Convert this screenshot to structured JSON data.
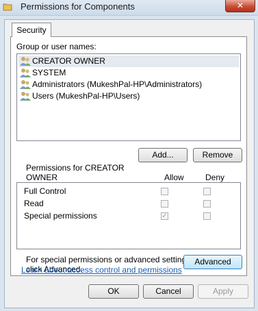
{
  "window": {
    "title": "Permissions for Components",
    "close_glyph": "✕"
  },
  "tabs": [
    {
      "label": "Security"
    }
  ],
  "group_label": "Group or user names:",
  "users": [
    {
      "name": "CREATOR OWNER",
      "selected": true
    },
    {
      "name": "SYSTEM",
      "selected": false
    },
    {
      "name": "Administrators (MukeshPal-HP\\Administrators)",
      "selected": false
    },
    {
      "name": "Users (MukeshPal-HP\\Users)",
      "selected": false
    }
  ],
  "buttons": {
    "add": "Add...",
    "remove": "Remove",
    "advanced": "Advanced",
    "ok": "OK",
    "cancel": "Cancel",
    "apply": "Apply"
  },
  "permissions": {
    "heading_line1": "Permissions for CREATOR",
    "heading_line2": "OWNER",
    "allow_label": "Allow",
    "deny_label": "Deny",
    "rows": [
      {
        "name": "Full Control",
        "allow": false,
        "deny": false
      },
      {
        "name": "Read",
        "allow": false,
        "deny": false
      },
      {
        "name": "Special permissions",
        "allow": true,
        "deny": false
      }
    ]
  },
  "special_note_line1": "For special permissions or advanced settings,",
  "special_note_line2": "click Advanced.",
  "link_text": "Learn about access control and permissions",
  "colors": {
    "close": "#c94f36",
    "link": "#1a5fb4",
    "selection": "#e5eaf0"
  },
  "icons": {
    "title": "folder-icon",
    "user": "user-group-icon",
    "check": "checkmark-icon"
  }
}
